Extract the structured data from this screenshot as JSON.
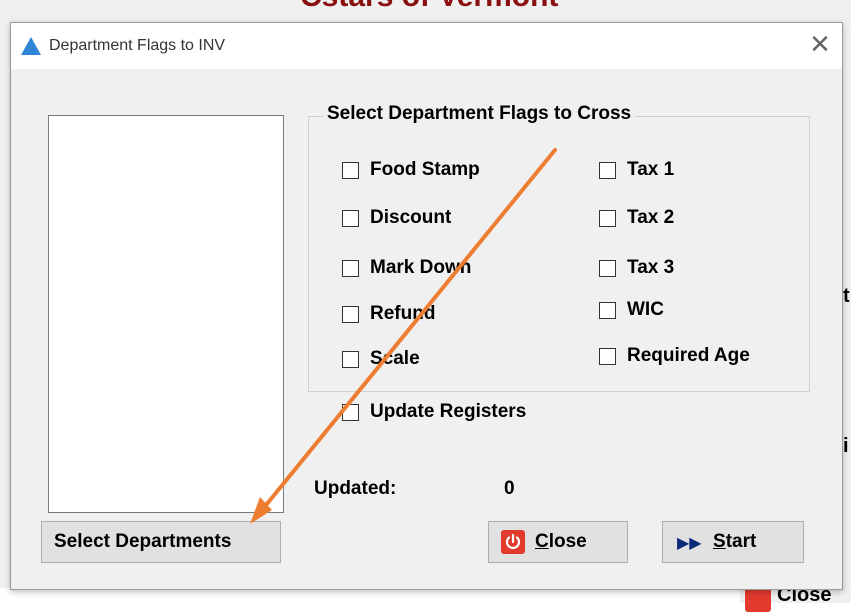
{
  "background": {
    "title": "Cstars of Vermont",
    "close_label": "Close"
  },
  "dialog": {
    "title": "Department Flags to INV",
    "close_icon": "close-x-icon"
  },
  "group": {
    "legend": "Select Department Flags to Cross",
    "flags": [
      {
        "label": "Food Stamp",
        "checked": false
      },
      {
        "label": "Discount",
        "checked": false
      },
      {
        "label": "Mark Down",
        "checked": false
      },
      {
        "label": "Refund",
        "checked": false
      },
      {
        "label": "Scale",
        "checked": false
      },
      {
        "label": "Tax 1",
        "checked": false
      },
      {
        "label": "Tax 2",
        "checked": false
      },
      {
        "label": "Tax 3",
        "checked": false
      },
      {
        "label": "WIC",
        "checked": false
      },
      {
        "label": "Required Age",
        "checked": false
      }
    ]
  },
  "update_registers": {
    "label": "Update Registers",
    "checked": false
  },
  "status": {
    "updated_label": "Updated:",
    "updated_value": "0"
  },
  "buttons": {
    "select_departments": "Select Departments",
    "close": "Close",
    "start": "Start"
  },
  "colors": {
    "annotation_arrow": "#ed7d31",
    "title_icon": "#2f86d6",
    "power_icon": "#e23b2e"
  }
}
